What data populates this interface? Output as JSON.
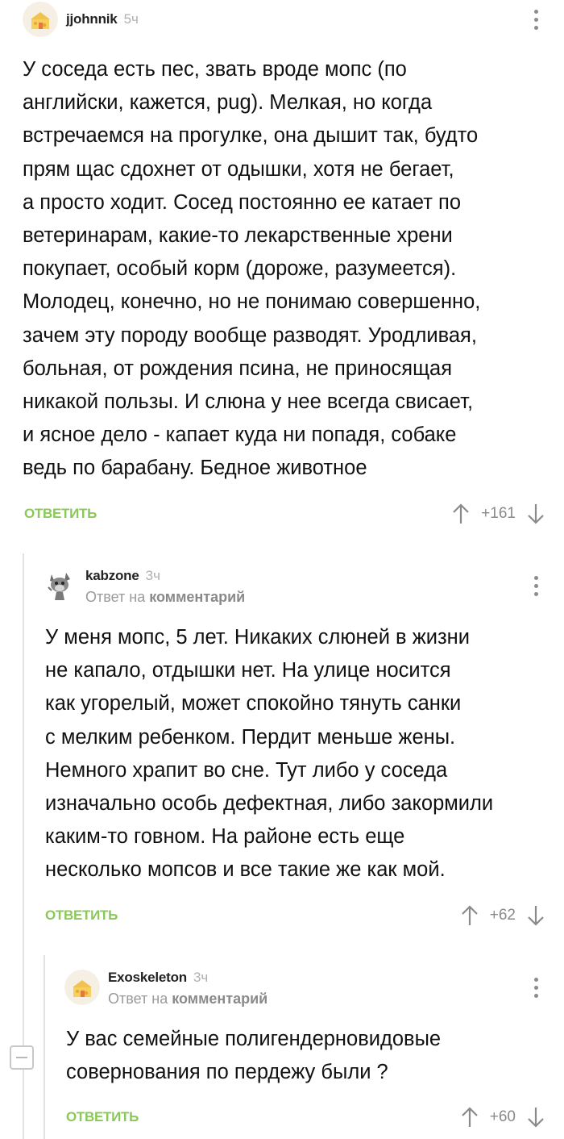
{
  "comments": [
    {
      "author": "jjohnnik",
      "time": "5ч",
      "avatar_icon": "cheese-house-avatar",
      "lines": [
        "У соседа есть пес, звать вроде мопс (по",
        "английски, кажется, pug). Мелкая, но когда",
        "встречаемся на прогулке, она дышит так, будто",
        "прям щас сдохнет от одышки, хотя не бегает,",
        "а просто ходит. Сосед постоянно ее катает по",
        "ветеринарам, какие-то лекарственные хрени",
        "покупает, особый корм (дороже, разумеется).",
        "Молодец, конечно, но не понимаю совершенно,",
        "зачем эту породу вообще разводят. Уродливая,",
        "больная, от рождения псина, не приносящая",
        "никакой пользы. И слюна у нее всегда свисает,",
        "и ясное дело - капает куда ни попадя, собаке",
        "ведь по барабану. Бедное животное"
      ],
      "reply_label": "ОТВЕТИТЬ",
      "score": "+161"
    },
    {
      "author": "kabzone",
      "time": "3ч",
      "avatar_icon": "cartoon-cat-avatar",
      "reply_prefix": "Ответ на",
      "reply_target": "комментарий",
      "lines": [
        "У меня мопс, 5 лет. Никаких слюней в жизни",
        "не капало, отдышки нет. На улице носится",
        "как угорелый, может спокойно тянуть санки",
        "с мелким ребенком. Пердит меньше жены.",
        "Немного храпит во сне. Тут либо у соседа",
        "изначально особь дефектная, либо закормили",
        "каким-то говном. На районе есть еще",
        "несколько мопсов и все такие же как мой."
      ],
      "reply_label": "ОТВЕТИТЬ",
      "score": "+62"
    },
    {
      "author": "Exoskeleton",
      "time": "3ч",
      "avatar_icon": "cheese-house-avatar",
      "reply_prefix": "Ответ на",
      "reply_target": "комментарий",
      "lines": [
        "У вас семейные полигендерновидовые",
        "совернования по пердежу были ?"
      ],
      "reply_label": "ОТВЕТИТЬ",
      "score": "+60"
    }
  ],
  "colors": {
    "reply_green": "#8ac858",
    "muted_gray": "#9a9a9a",
    "thread_line": "#e2e2e2"
  }
}
